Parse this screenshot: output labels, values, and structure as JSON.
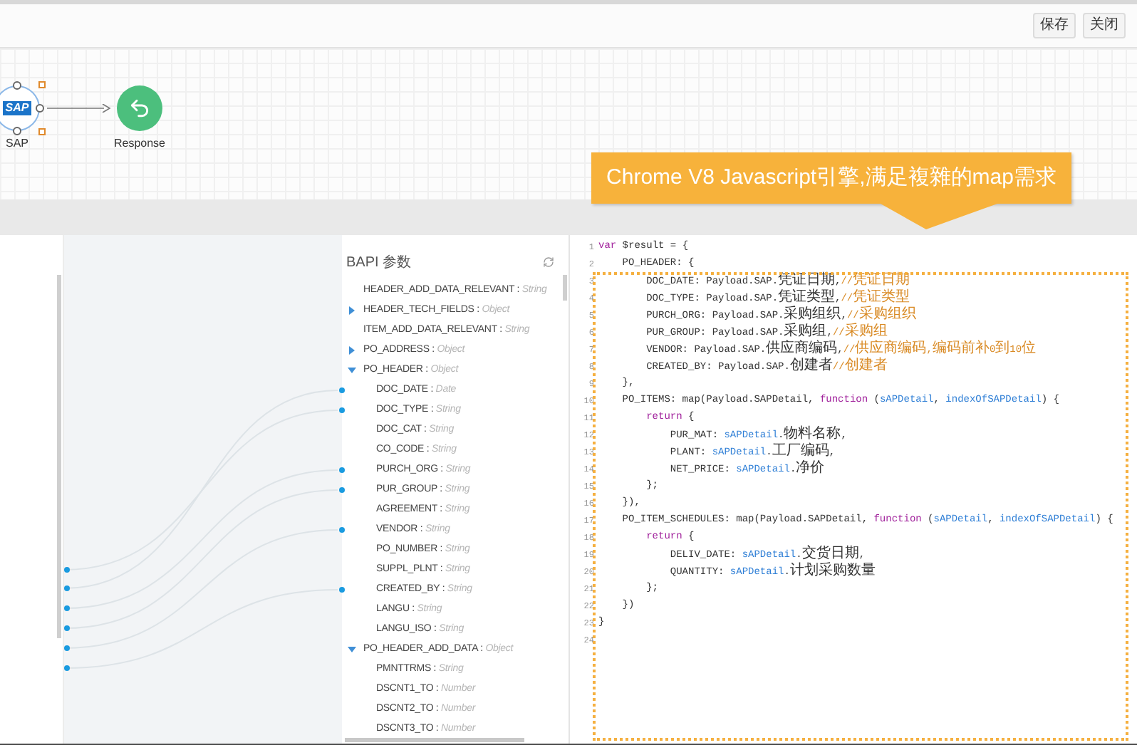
{
  "toolbar": {
    "buttons": [
      "保存",
      "关闭"
    ]
  },
  "flow": {
    "nodes": [
      {
        "kind": "sap",
        "logo_text": "SAP",
        "label": "SAP",
        "selected": true
      },
      {
        "kind": "response",
        "label": "Response",
        "selected": false
      }
    ]
  },
  "callout": {
    "text": "Chrome V8 Javascript引擎,满足複雜的map需求"
  },
  "bapi_panel": {
    "title": "BAPI 参数",
    "params": [
      {
        "name": "HEADER_ADD_DATA_RELEVANT :",
        "type": "String",
        "mapped": false
      },
      {
        "name": "HEADER_TECH_FIELDS :",
        "type": "Object",
        "mapped": false,
        "expanded": false
      },
      {
        "name": "ITEM_ADD_DATA_RELEVANT :",
        "type": "String",
        "mapped": false
      },
      {
        "name": "PO_ADDRESS :",
        "type": "Object",
        "mapped": false,
        "expanded": false
      },
      {
        "name": "PO_HEADER :",
        "type": "Object",
        "mapped": false,
        "expanded": true,
        "children": [
          {
            "name": "DOC_DATE :",
            "type": "Date",
            "mapped": true
          },
          {
            "name": "DOC_TYPE :",
            "type": "String",
            "mapped": true
          },
          {
            "name": "DOC_CAT :",
            "type": "String",
            "mapped": false
          },
          {
            "name": "CO_CODE :",
            "type": "String",
            "mapped": false
          },
          {
            "name": "PURCH_ORG :",
            "type": "String",
            "mapped": true
          },
          {
            "name": "PUR_GROUP :",
            "type": "String",
            "mapped": true
          },
          {
            "name": "AGREEMENT :",
            "type": "String",
            "mapped": false
          },
          {
            "name": "VENDOR :",
            "type": "String",
            "mapped": true
          },
          {
            "name": "PO_NUMBER :",
            "type": "String",
            "mapped": false
          },
          {
            "name": "SUPPL_PLNT :",
            "type": "String",
            "mapped": false
          },
          {
            "name": "CREATED_BY :",
            "type": "String",
            "mapped": true
          },
          {
            "name": "LANGU :",
            "type": "String",
            "mapped": false
          },
          {
            "name": "LANGU_ISO :",
            "type": "String",
            "mapped": false
          }
        ]
      },
      {
        "name": "PO_HEADER_ADD_DATA :",
        "type": "Object",
        "mapped": false,
        "expanded": true,
        "children": [
          {
            "name": "PMNTTRMS :",
            "type": "String",
            "mapped": false
          },
          {
            "name": "DSCNT1_TO :",
            "type": "Number",
            "mapped": false
          },
          {
            "name": "DSCNT2_TO :",
            "type": "Number",
            "mapped": false
          },
          {
            "name": "DSCNT3_TO :",
            "type": "Number",
            "mapped": false
          }
        ]
      }
    ]
  },
  "code_editor": {
    "lines": [
      {
        "n": "1",
        "segs": [
          {
            "kind": "keyword",
            "t": "var"
          },
          {
            "kind": "plain",
            "t": " $result = {"
          }
        ]
      },
      {
        "n": "2",
        "segs": [
          {
            "kind": "plain",
            "t": "    PO_HEADER: {"
          }
        ]
      },
      {
        "n": "3",
        "segs": [
          {
            "kind": "plain",
            "t": "        DOC_DATE: Payload.SAP.凭证日期,"
          },
          {
            "kind": "comment",
            "t": "//凭证日期"
          }
        ]
      },
      {
        "n": "4",
        "segs": [
          {
            "kind": "plain",
            "t": "        DOC_TYPE: Payload.SAP.凭证类型,"
          },
          {
            "kind": "comment",
            "t": "//凭证类型"
          }
        ]
      },
      {
        "n": "5",
        "segs": [
          {
            "kind": "plain",
            "t": "        PURCH_ORG: Payload.SAP.采购组织,"
          },
          {
            "kind": "comment",
            "t": "//采购组织"
          }
        ]
      },
      {
        "n": "6",
        "segs": [
          {
            "kind": "plain",
            "t": "        PUR_GROUP: Payload.SAP.采购组,"
          },
          {
            "kind": "comment",
            "t": "//采购组"
          }
        ]
      },
      {
        "n": "7",
        "segs": [
          {
            "kind": "plain",
            "t": "        VENDOR: Payload.SAP.供应商编码,"
          },
          {
            "kind": "comment",
            "t": "//供应商编码,编码前补0到10位"
          }
        ]
      },
      {
        "n": "8",
        "segs": [
          {
            "kind": "plain",
            "t": "        CREATED_BY: Payload.SAP.创建者"
          },
          {
            "kind": "comment",
            "t": "//创建者"
          }
        ]
      },
      {
        "n": "9",
        "segs": [
          {
            "kind": "plain",
            "t": "    },"
          }
        ]
      },
      {
        "n": "10",
        "segs": [
          {
            "kind": "plain",
            "t": "    PO_ITEMS: map(Payload.SAPDetail, "
          },
          {
            "kind": "keyword",
            "t": "function"
          },
          {
            "kind": "plain",
            "t": " ("
          },
          {
            "kind": "variable",
            "t": "sAPDetail"
          },
          {
            "kind": "plain",
            "t": ", "
          },
          {
            "kind": "variable",
            "t": "indexOfSAPDetail"
          },
          {
            "kind": "plain",
            "t": ") {"
          }
        ]
      },
      {
        "n": "11",
        "segs": [
          {
            "kind": "keyword",
            "t": "        return"
          },
          {
            "kind": "plain",
            "t": " {"
          }
        ]
      },
      {
        "n": "12",
        "segs": [
          {
            "kind": "plain",
            "t": "            PUR_MAT: "
          },
          {
            "kind": "variable",
            "t": "sAPDetail"
          },
          {
            "kind": "plain",
            "t": ".物料名称,"
          }
        ]
      },
      {
        "n": "13",
        "segs": [
          {
            "kind": "plain",
            "t": "            PLANT: "
          },
          {
            "kind": "variable",
            "t": "sAPDetail"
          },
          {
            "kind": "plain",
            "t": ".工厂编码,"
          }
        ]
      },
      {
        "n": "14",
        "segs": [
          {
            "kind": "plain",
            "t": "            NET_PRICE: "
          },
          {
            "kind": "variable",
            "t": "sAPDetail"
          },
          {
            "kind": "plain",
            "t": ".净价"
          }
        ]
      },
      {
        "n": "15",
        "segs": [
          {
            "kind": "plain",
            "t": "        };"
          }
        ]
      },
      {
        "n": "16",
        "segs": [
          {
            "kind": "plain",
            "t": "    }),"
          }
        ]
      },
      {
        "n": "17",
        "segs": [
          {
            "kind": "plain",
            "t": "    PO_ITEM_SCHEDULES: map(Payload.SAPDetail, "
          },
          {
            "kind": "keyword",
            "t": "function"
          },
          {
            "kind": "plain",
            "t": " ("
          },
          {
            "kind": "variable",
            "t": "sAPDetail"
          },
          {
            "kind": "plain",
            "t": ", "
          },
          {
            "kind": "variable",
            "t": "indexOfSAPDetail"
          },
          {
            "kind": "plain",
            "t": ") {"
          }
        ]
      },
      {
        "n": "18",
        "segs": [
          {
            "kind": "keyword",
            "t": "        return"
          },
          {
            "kind": "plain",
            "t": " {"
          }
        ]
      },
      {
        "n": "19",
        "segs": [
          {
            "kind": "plain",
            "t": "            DELIV_DATE: "
          },
          {
            "kind": "variable",
            "t": "sAPDetail"
          },
          {
            "kind": "plain",
            "t": ".交货日期,"
          }
        ]
      },
      {
        "n": "20",
        "segs": [
          {
            "kind": "plain",
            "t": "            QUANTITY: "
          },
          {
            "kind": "variable",
            "t": "sAPDetail"
          },
          {
            "kind": "plain",
            "t": ".计划采购数量"
          }
        ]
      },
      {
        "n": "21",
        "segs": [
          {
            "kind": "plain",
            "t": "        };"
          }
        ]
      },
      {
        "n": "22",
        "segs": [
          {
            "kind": "plain",
            "t": "    })"
          }
        ]
      },
      {
        "n": "23",
        "segs": [
          {
            "kind": "plain",
            "t": "}"
          }
        ]
      },
      {
        "n": "24"
      }
    ]
  }
}
